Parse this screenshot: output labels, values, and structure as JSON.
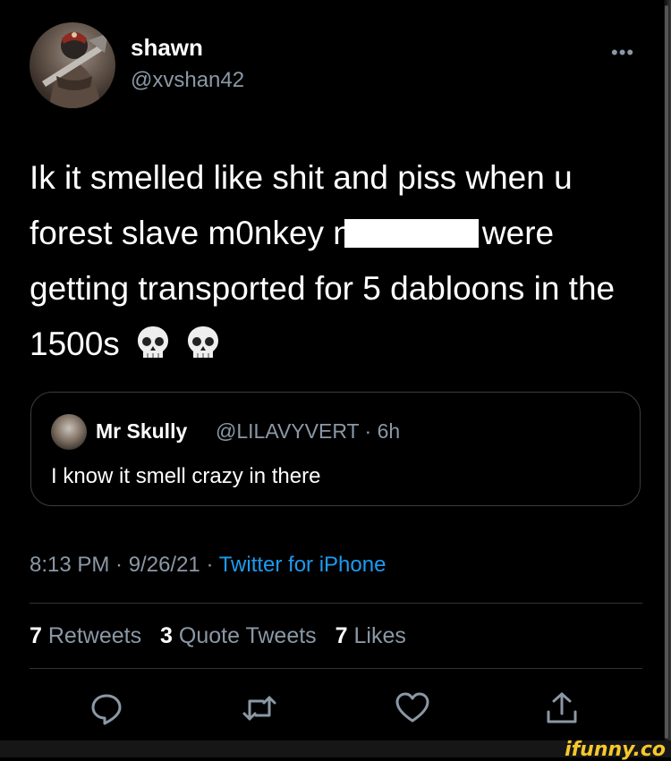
{
  "tweet": {
    "author_name": "shawn",
    "author_handle": "@xvshan42",
    "more_label": "•••",
    "text_segment_1": "Ik it smelled like shit and piss when u forest slave m0nkey n",
    "text_segment_2": "were getting transported for 5 dabloons in the 1500s",
    "emoji_1": "💀",
    "emoji_2": "💀",
    "timestamp": "8:13 PM · 9/26/21 · ",
    "source": "Twitter for iPhone"
  },
  "quote": {
    "author_name": "Mr Skully",
    "meta": "@LILAVYVERT · 6h",
    "text": "I know it smell crazy in there"
  },
  "stats": {
    "retweets_count": "7",
    "retweets_label": "Retweets",
    "quote_tweets_count": "3",
    "quote_tweets_label": "Quote Tweets",
    "likes_count": "7",
    "likes_label": "Likes"
  },
  "watermark": "ifunny.co",
  "colors": {
    "background": "#000000",
    "text": "#ffffff",
    "secondary_text": "#8b98a5",
    "link": "#1d9bf0",
    "divider": "#2f3336"
  },
  "icons": {
    "reply": "reply-icon",
    "retweet": "retweet-icon",
    "like": "heart-icon",
    "share": "share-icon"
  }
}
